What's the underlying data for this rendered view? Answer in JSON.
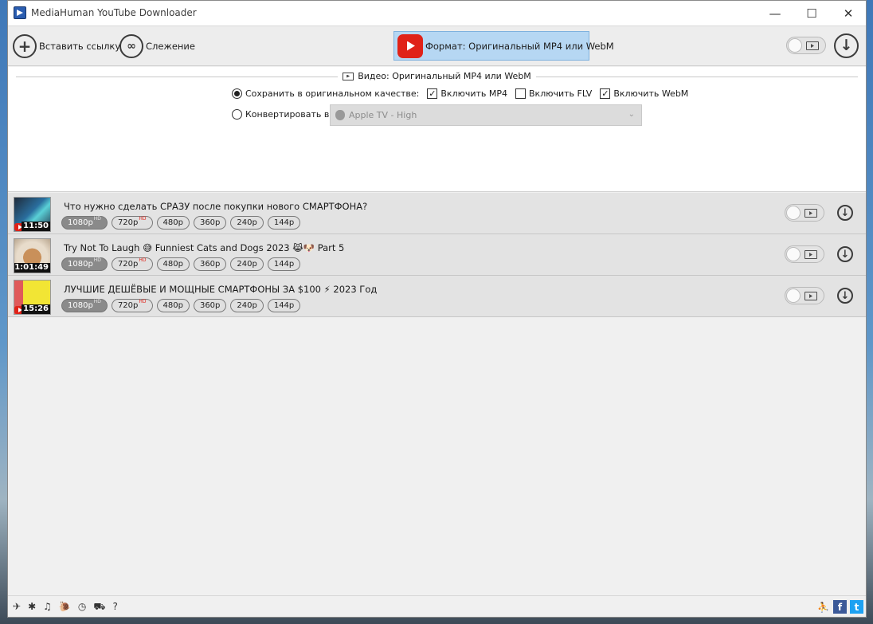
{
  "window": {
    "title": "MediaHuman YouTube Downloader",
    "controls": {
      "minimize": "—",
      "maximize": "☐",
      "close": "✕"
    }
  },
  "toolbar": {
    "paste_link": "Вставить ссылку",
    "tracking": "Слежение",
    "format": "Формат: Оригинальный MP4 или WebM"
  },
  "settings": {
    "section_title": "Видео: Оригинальный MP4 или WebM",
    "save_original_label": "Сохранить в оригинальном качестве:",
    "include_mp4": "Включить MP4",
    "include_flv": "Включить FLV",
    "include_webm": "Включить WebM",
    "convert_label": "Конвертировать в:",
    "convert_preset": "Apple TV - High",
    "checks": {
      "mp4": true,
      "flv": false,
      "webm": true
    },
    "mode": "original"
  },
  "videos": [
    {
      "title": "Что нужно сделать СРАЗУ после покупки нового СМАРТФОНА?",
      "duration": "11:50",
      "qualities": [
        {
          "label": "1080p",
          "hd": "HD",
          "selected": true
        },
        {
          "label": "720p",
          "hd": "HD",
          "selected": false
        },
        {
          "label": "480p",
          "hd": "",
          "selected": false
        },
        {
          "label": "360p",
          "hd": "",
          "selected": false
        },
        {
          "label": "240p",
          "hd": "",
          "selected": false
        },
        {
          "label": "144p",
          "hd": "",
          "selected": false
        }
      ]
    },
    {
      "title": "Try Not To Laugh 😅 Funniest Cats and Dogs 2023 😹🐶 Part 5",
      "duration": "1:01:49",
      "qualities": [
        {
          "label": "1080p",
          "hd": "HD",
          "selected": true
        },
        {
          "label": "720p",
          "hd": "HD",
          "selected": false
        },
        {
          "label": "480p",
          "hd": "",
          "selected": false
        },
        {
          "label": "360p",
          "hd": "",
          "selected": false
        },
        {
          "label": "240p",
          "hd": "",
          "selected": false
        },
        {
          "label": "144p",
          "hd": "",
          "selected": false
        }
      ]
    },
    {
      "title": "ЛУЧШИЕ ДЕШЁВЫЕ И МОЩНЫЕ СМАРТФОНЫ ЗА $100 ⚡ 2023 Год",
      "duration": "15:26",
      "qualities": [
        {
          "label": "1080p",
          "hd": "HD",
          "selected": true
        },
        {
          "label": "720p",
          "hd": "HD",
          "selected": false
        },
        {
          "label": "480p",
          "hd": "",
          "selected": false
        },
        {
          "label": "360p",
          "hd": "",
          "selected": false
        },
        {
          "label": "240p",
          "hd": "",
          "selected": false
        },
        {
          "label": "144p",
          "hd": "",
          "selected": false
        }
      ]
    }
  ],
  "statusbar": {
    "left_icons": [
      "send-icon",
      "gear-icon",
      "music-note-icon",
      "snail-icon",
      "clock-icon",
      "binoculars-icon",
      "help-icon"
    ],
    "left_glyphs": [
      "✈",
      "✱",
      "♫",
      "🐌",
      "◷",
      "⛟",
      "?"
    ],
    "right_icons": [
      "user-icon",
      "facebook-icon",
      "twitter-icon"
    ],
    "facebook_glyph": "f",
    "twitter_glyph": "t"
  },
  "colors": {
    "accent": "#b6d7f3",
    "youtube_red": "#e02218",
    "hd_red": "#e02218"
  }
}
